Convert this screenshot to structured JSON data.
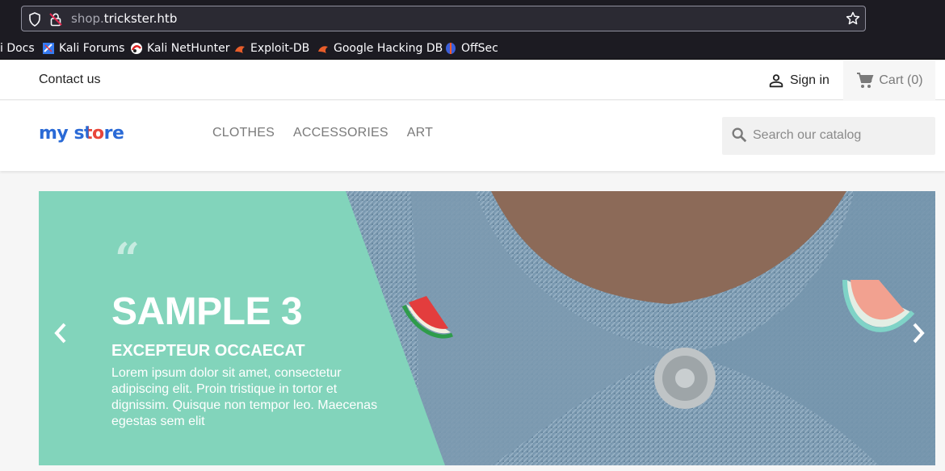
{
  "browser": {
    "url_domain_prefix": "shop.",
    "url_domain_main": "trickster.htb",
    "bookmarks": [
      {
        "label": "i Docs",
        "icon": "kali-icon"
      },
      {
        "label": "Kali Forums",
        "icon": "kali-forums-icon"
      },
      {
        "label": "Kali NetHunter",
        "icon": "nethunter-icon"
      },
      {
        "label": "Exploit-DB",
        "icon": "exploitdb-icon"
      },
      {
        "label": "Google Hacking DB",
        "icon": "ghdb-icon"
      },
      {
        "label": "OffSec",
        "icon": "offsec-icon"
      }
    ]
  },
  "topnav": {
    "contact": "Contact us",
    "signin": "Sign in",
    "cart": "Cart (0)"
  },
  "header": {
    "logo_my": "my",
    "logo_store": "store",
    "menu": [
      "CLOTHES",
      "ACCESSORIES",
      "ART"
    ],
    "search_placeholder": "Search our catalog"
  },
  "slide": {
    "quote_mark": "“",
    "title": "SAMPLE 3",
    "subtitle": "EXCEPTEUR OCCAECAT",
    "description": "Lorem ipsum dolor sit amet, consectetur adipiscing elit. Proin tristique in tortor et dignissim. Quisque non tempor leo. Maecenas egestas sem elit"
  },
  "colors": {
    "accent": "#82d4bb",
    "browser_bg": "#1c1b22",
    "text": "#232323"
  }
}
